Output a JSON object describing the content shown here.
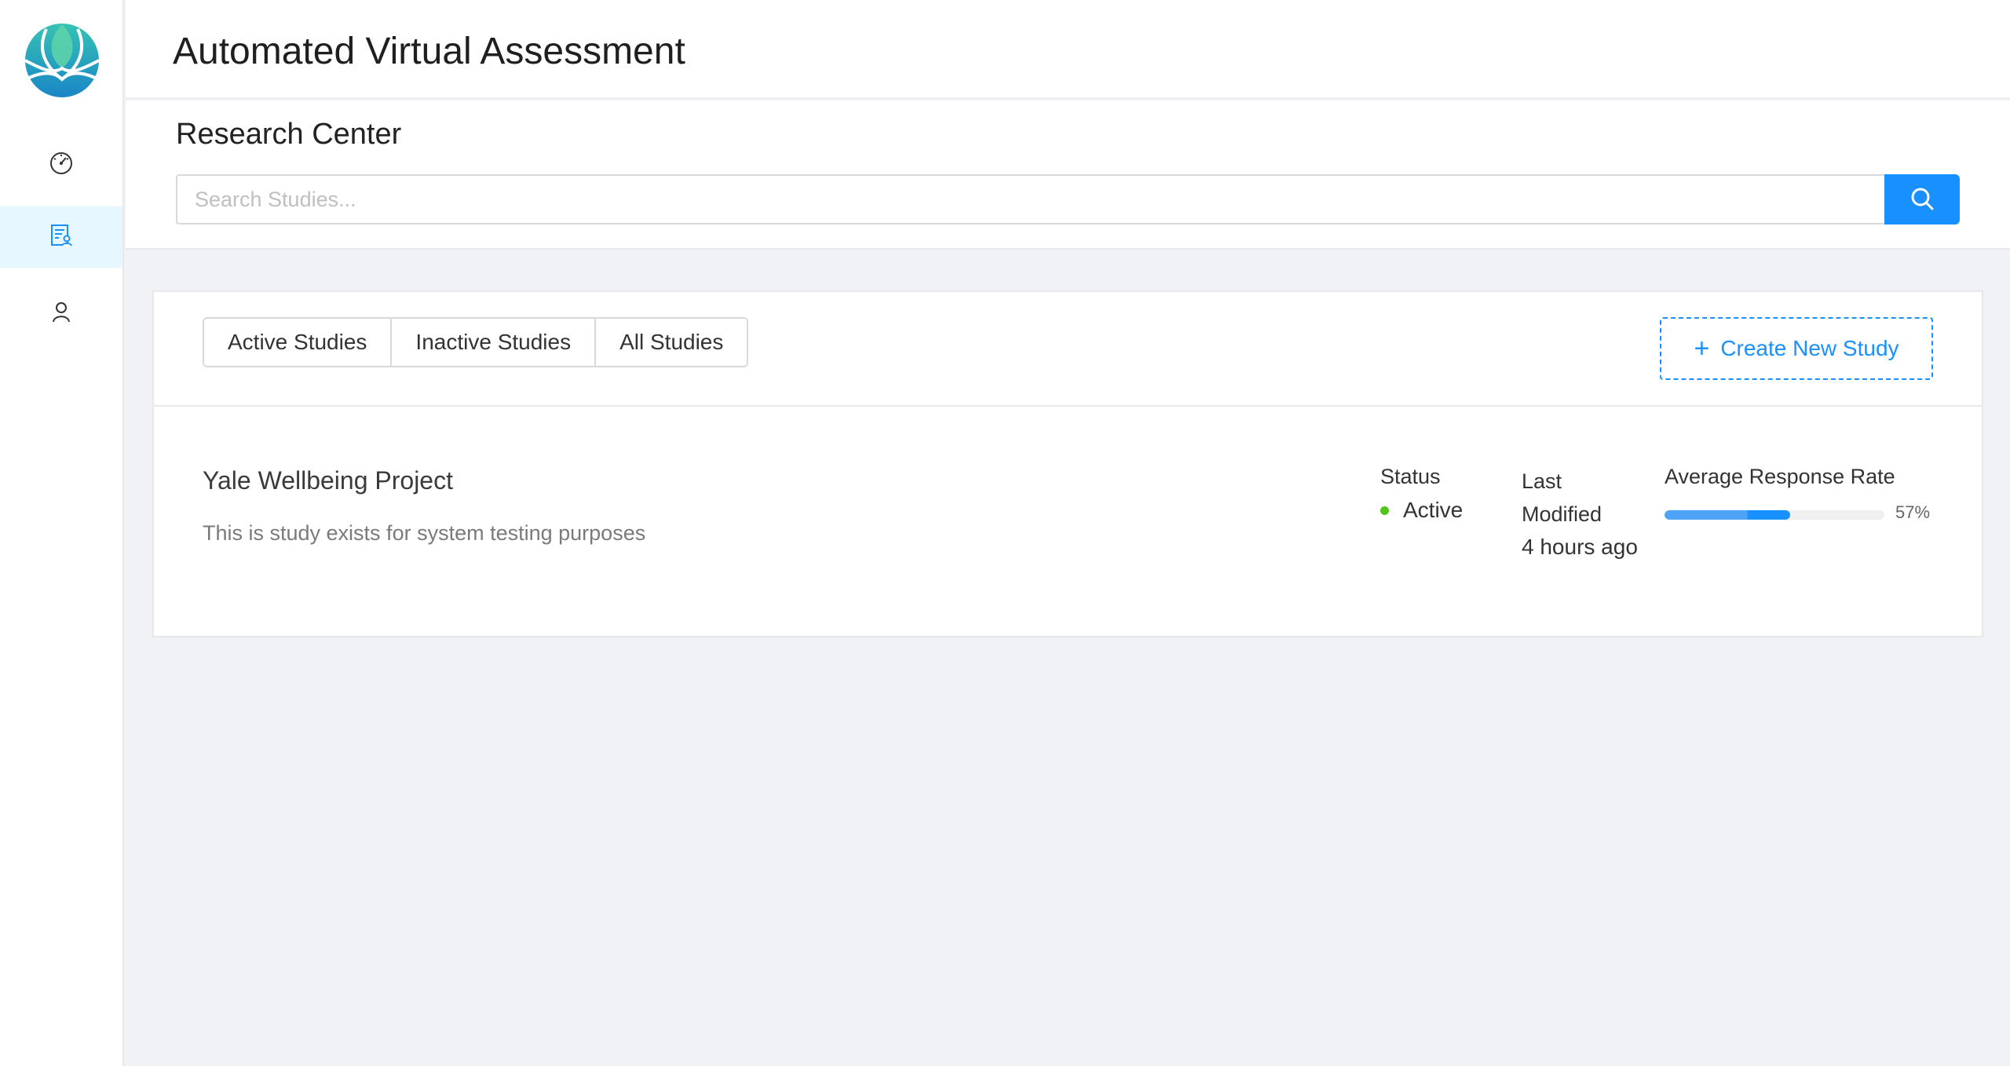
{
  "header": {
    "title": "Automated Virtual Assessment"
  },
  "sidebar": {
    "items": [
      {
        "name": "dashboard",
        "icon": "speedometer-icon",
        "active": false
      },
      {
        "name": "studies",
        "icon": "study-document-icon",
        "active": true
      },
      {
        "name": "profile",
        "icon": "user-icon",
        "active": false
      }
    ]
  },
  "research": {
    "title": "Research Center",
    "search_placeholder": "Search Studies...",
    "search_value": ""
  },
  "tabs": [
    "Active Studies",
    "Inactive Studies",
    "All Studies"
  ],
  "create_button": {
    "label": "Create New Study",
    "icon": "plus-icon"
  },
  "study": {
    "title": "Yale Wellbeing Project",
    "description": "This is study exists for system testing purposes",
    "status_label": "Status",
    "status_value": "Active",
    "status_color": "#52c41a",
    "modified_label": "Last Modified",
    "modified_value": "4 hours ago",
    "rate_label": "Average Response Rate",
    "rate_percent": 57,
    "rate_text": "57%"
  },
  "colors": {
    "primary": "#1890ff",
    "active_nav_bg": "#e6f7ff",
    "page_bg": "#f0f2f5"
  }
}
